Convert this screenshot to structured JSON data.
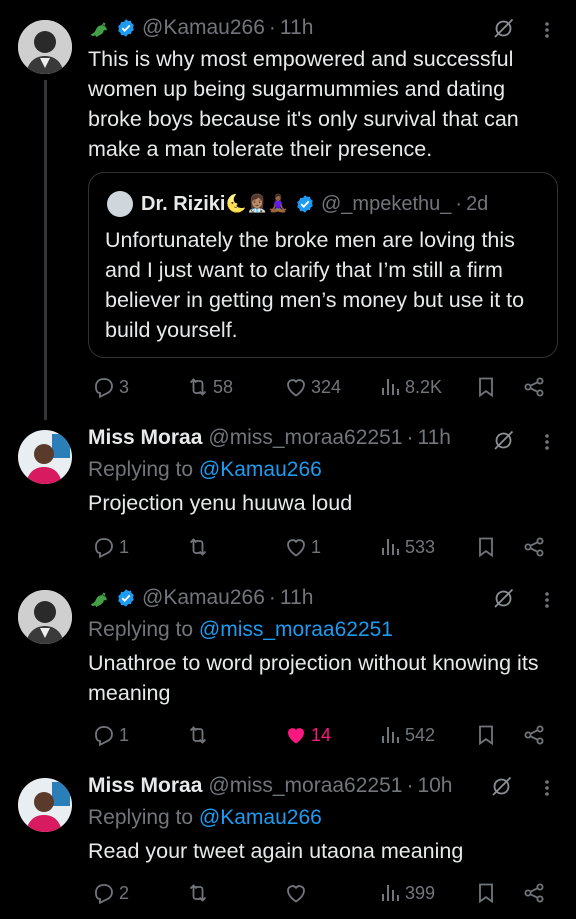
{
  "tweets": [
    {
      "handle": "@Kamau266",
      "time": "11h",
      "text": "This is why most empowered and successful women  up being sugarmummies and dating broke boys because it's only survival that can make a man tolerate their presence.",
      "quote": {
        "name": "Dr. Riziki",
        "name_emojis": "🌜👩🏽‍⚕️🧘🏾‍♀️",
        "handle": "@_mpekethu_",
        "time": "2d",
        "text": "Unfortunately the broke men are loving this and I just want to clarify that I’m still a firm believer in getting men’s money but use it to build yourself."
      },
      "replies": "3",
      "reposts": "58",
      "likes": "324",
      "views": "8.2K"
    },
    {
      "name": "Miss Moraa",
      "handle": "@miss_moraa62251",
      "time": "11h",
      "replying_prefix": "Replying to",
      "replying_to": "@Kamau266",
      "text": "Projection yenu huuwa loud",
      "replies": "1",
      "reposts": "",
      "likes": "1",
      "views": "533"
    },
    {
      "handle": "@Kamau266",
      "time": "11h",
      "replying_prefix": "Replying to",
      "replying_to": "@miss_moraa62251",
      "text": "Unathroe to word projection without knowing its meaning",
      "replies": "1",
      "reposts": "",
      "likes": "14",
      "views": "542"
    },
    {
      "name": "Miss Moraa",
      "handle": "@miss_moraa62251",
      "time": "10h",
      "replying_prefix": "Replying to",
      "replying_to": "@Kamau266",
      "text": "Read your tweet again utaona meaning",
      "replies": "2",
      "reposts": "",
      "likes": "",
      "views": "399"
    }
  ],
  "colors": {
    "accent": "#1d9bf0",
    "like": "#f91880",
    "muted": "#71767b",
    "text": "#e7e9ea"
  },
  "icons": [
    "dragon-emoji-icon",
    "verified-badge-icon",
    "grok-icon",
    "more-icon",
    "reply-icon",
    "repost-icon",
    "like-icon",
    "views-icon",
    "bookmark-icon",
    "share-icon"
  ]
}
